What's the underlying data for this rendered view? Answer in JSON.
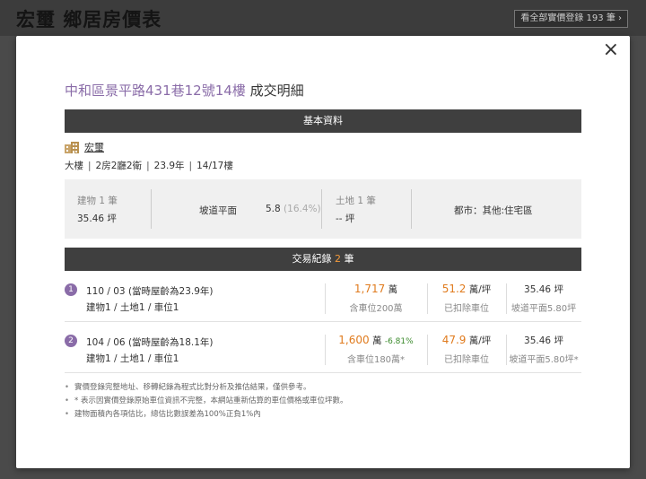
{
  "background": {
    "title": "宏璽 鄉居房價表",
    "all_records_button": "看全部實價登錄 193 筆 ›"
  },
  "modal": {
    "close_glyph": "×",
    "title_address": "中和區景平路431巷12號14樓",
    "title_suffix": "成交明細",
    "basic_info_header": "基本資料",
    "builder_name": "宏璽",
    "specs": [
      "大樓",
      "2房2廳2衛",
      "23.9年",
      "14/17樓"
    ],
    "spec_separator": "|",
    "info": {
      "building_label": "建物 1 筆",
      "building_area": "35.46 坪",
      "ramp_label": "坡道平面",
      "ramp_value": "5.8",
      "ramp_pct": "(16.4%)",
      "land_label": "土地 1 筆",
      "land_area": "-- 坪",
      "zoning": "都市：其他:住宅區"
    },
    "tx_header_prefix": "交易紀錄",
    "tx_count": "2",
    "tx_header_suffix": "筆",
    "transactions": [
      {
        "index": "1",
        "date_age": "110 / 03 (當時屋齡為23.9年)",
        "counts": "建物1 / 土地1 / 車位1",
        "total_num": "1,717",
        "total_unit": "萬",
        "change": "",
        "total_note": "含車位200萬",
        "unit_num": "51.2",
        "unit_unit": "萬/坪",
        "unit_note": "已扣除車位",
        "area": "35.46 坪",
        "area_note": "坡道平面5.80坪"
      },
      {
        "index": "2",
        "date_age": "104 / 06 (當時屋齡為18.1年)",
        "counts": "建物1 / 土地1 / 車位1",
        "total_num": "1,600",
        "total_unit": "萬",
        "change": "-6.81%",
        "total_note": "含車位180萬*",
        "unit_num": "47.9",
        "unit_unit": "萬/坪",
        "unit_note": "已扣除車位",
        "area": "35.46 坪",
        "area_note": "坡道平面5.80坪*"
      }
    ],
    "notes": [
      "實價登錄完整地址、移轉紀錄為程式比對分析及推估結果，僅供參考。",
      "* 表示因實價登錄原始車位資訊不完整，本網站重新估算的車位價格或車位坪數。",
      "建物面積內各項估比，總估比數誤差為100%正負1%內"
    ]
  },
  "colors": {
    "accent_purple": "#8a6ca8",
    "price_orange": "#e07b1e",
    "change_green": "#3a8a2b",
    "header_bar": "#3f3f3f"
  }
}
